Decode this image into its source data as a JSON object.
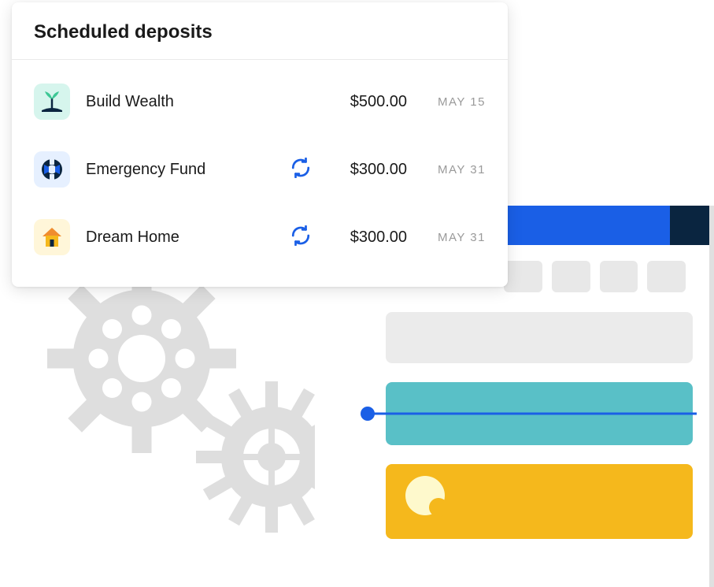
{
  "card": {
    "title": "Scheduled deposits",
    "deposits": [
      {
        "name": "Build Wealth",
        "amount": "$500.00",
        "date": "MAY 15",
        "recurring": false,
        "icon": "wealth"
      },
      {
        "name": "Emergency Fund",
        "amount": "$300.00",
        "date": "MAY 31",
        "recurring": true,
        "icon": "emergency"
      },
      {
        "name": "Dream Home",
        "amount": "$300.00",
        "date": "MAY 31",
        "recurring": true,
        "icon": "home"
      }
    ]
  },
  "colors": {
    "blue": "#1a5fe6",
    "navy": "#0a2540",
    "teal": "#59c0c7",
    "yellow": "#f5b81c",
    "gear": "#dedede"
  }
}
